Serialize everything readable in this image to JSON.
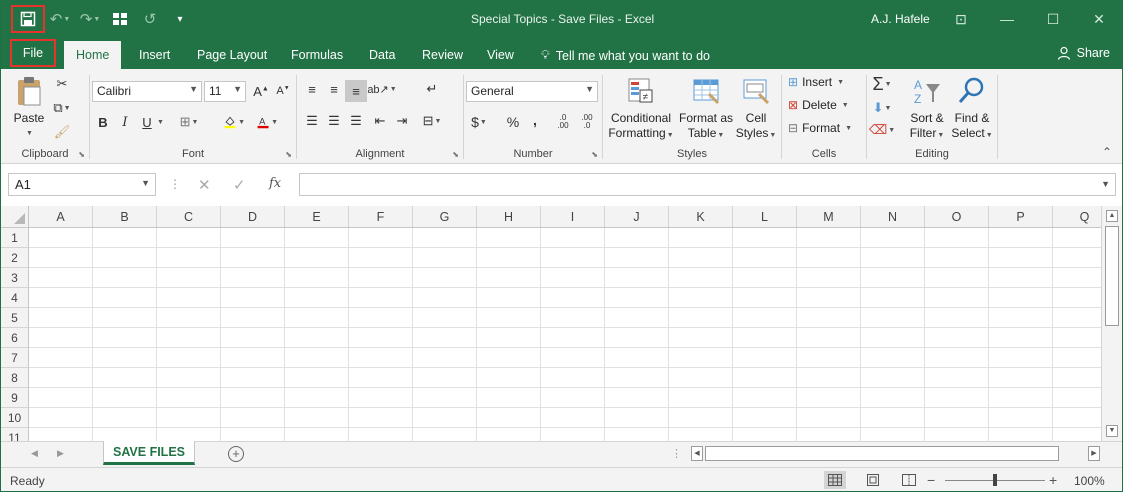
{
  "window": {
    "title": "Special Topics - Save Files - Excel",
    "user": "A.J. Hafele"
  },
  "tabs": {
    "file": "File",
    "items": [
      "Home",
      "Insert",
      "Page Layout",
      "Formulas",
      "Data",
      "Review",
      "View"
    ],
    "active": "Home",
    "tell_me": "Tell me what you want to do",
    "share": "Share"
  },
  "ribbon": {
    "clipboard": {
      "label": "Clipboard",
      "paste": "Paste"
    },
    "font": {
      "label": "Font",
      "name": "Calibri",
      "size": "11",
      "bold": "B",
      "italic": "I",
      "underline": "U"
    },
    "alignment": {
      "label": "Alignment"
    },
    "number": {
      "label": "Number",
      "format": "General",
      "currency": "$",
      "percent": "%",
      "comma": ",",
      "inc_decimal": ".00",
      "dec_decimal": ".0"
    },
    "styles": {
      "label": "Styles",
      "conditional_1": "Conditional",
      "conditional_2": "Formatting",
      "format_as_1": "Format as",
      "format_as_2": "Table",
      "cell_styles_1": "Cell",
      "cell_styles_2": "Styles"
    },
    "cells": {
      "label": "Cells",
      "insert": "Insert",
      "delete": "Delete",
      "format": "Format"
    },
    "editing": {
      "label": "Editing",
      "sort_1": "Sort &",
      "sort_2": "Filter",
      "find_1": "Find &",
      "find_2": "Select"
    }
  },
  "formula_bar": {
    "name_box": "A1",
    "fx": "fx",
    "formula": ""
  },
  "sheet": {
    "columns": [
      "A",
      "B",
      "C",
      "D",
      "E",
      "F",
      "G",
      "H",
      "I",
      "J",
      "K",
      "L",
      "M",
      "N",
      "O",
      "P",
      "Q"
    ],
    "rows": [
      "1",
      "2",
      "3",
      "4",
      "5",
      "6",
      "7",
      "8",
      "9",
      "10",
      "11"
    ],
    "tab": "SAVE FILES"
  },
  "status": {
    "ready": "Ready",
    "zoom": "100%"
  },
  "colors": {
    "brand": "#217346",
    "highlight": "#e8332d"
  }
}
